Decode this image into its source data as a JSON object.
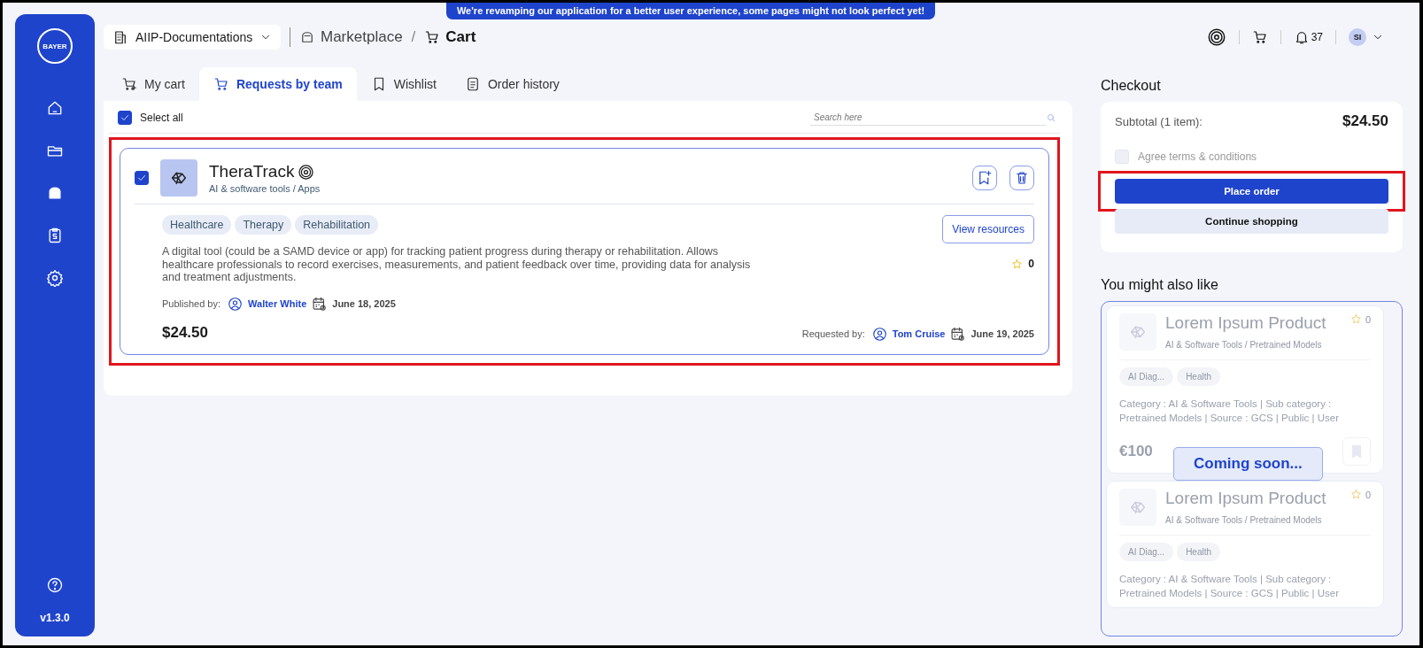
{
  "banner": "We're revamping our application for a better user experience, some pages might not look perfect yet!",
  "sidebar": {
    "logo": "BAYER",
    "items": [
      {
        "selected": false
      },
      {
        "selected": false
      },
      {
        "selected": true
      },
      {
        "selected": false
      },
      {
        "selected": false
      }
    ],
    "version": "v1.3.0"
  },
  "workspace": {
    "label": "AIIP-Documentations"
  },
  "breadcrumb": [
    {
      "label": "Marketplace",
      "kind": "section"
    },
    {
      "separator": "/",
      "label": "Cart",
      "kind": "current"
    }
  ],
  "header": {
    "notifications": "37",
    "avatar": "SI"
  },
  "tabs": [
    {
      "label": "My cart",
      "selected": false
    },
    {
      "label": "Requests by team",
      "selected": true
    },
    {
      "label": "Wishlist",
      "selected": false
    },
    {
      "label": "Order history",
      "selected": false
    }
  ],
  "cart": {
    "select_all": {
      "label": "Select all",
      "checked": true
    },
    "search": {
      "placeholder": "Search here"
    },
    "items": [
      {
        "checked": true,
        "highlighted": true,
        "title": "TheraTrack",
        "category": "AI & software tools / Apps",
        "tags": [
          "Healthcare",
          "Therapy",
          "Rehabilitation"
        ],
        "action": "View resources",
        "description": "A digital tool (could be a SAMD device or app) for tracking patient progress during therapy or rehabilitation. Allows healthcare professionals to record exercises, measurements, and patient feedback over time, providing data for analysis and treatment adjustments.",
        "rating": "0",
        "published_label": "Published by:",
        "publisher": "Walter White",
        "published_date": "June 18, 2025",
        "price": "$24.50",
        "requested_label": "Requested by:",
        "requester": "Tom Cruise",
        "requested_date": "June 19, 2025"
      }
    ]
  },
  "checkout": {
    "title": "Checkout",
    "subtotal_label": "Subtotal (1 item):",
    "subtotal": "$24.50",
    "terms": {
      "label": "Agree terms & conditions",
      "checked": false
    },
    "buttons": [
      {
        "label": "Place order",
        "kind": "primary",
        "highlighted": true
      },
      {
        "label": "Continue shopping",
        "kind": "secondary",
        "highlighted": false
      }
    ]
  },
  "recommendations": {
    "title": "You might also like",
    "overlay": "Coming soon...",
    "items": [
      {
        "title": "Lorem Ipsum Product",
        "category": "AI & Software Tools / Pretrained Models",
        "rating": "0",
        "tags": [
          "AI Diag...",
          "Health"
        ],
        "description": "Category : AI & Software Tools | Sub category : Pretrained Models | Source : GCS | Public | User",
        "price": "€100"
      },
      {
        "title": "Lorem Ipsum Product",
        "category": "AI & Software Tools / Pretrained Models",
        "rating": "0",
        "tags": [
          "AI Diag...",
          "Health"
        ],
        "description": "Category : AI & Software Tools | Sub category : Pretrained Models | Source : GCS | Public | User"
      }
    ]
  }
}
